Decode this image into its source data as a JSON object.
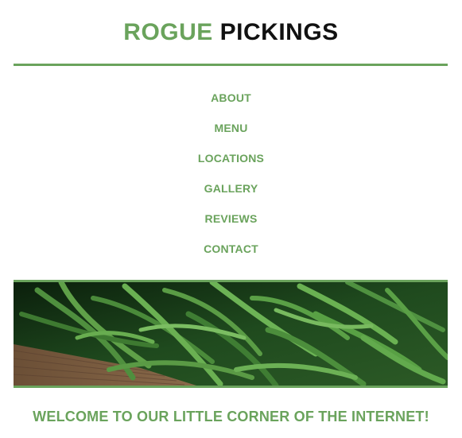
{
  "site": {
    "title_part1": "ROGUE",
    "title_part2": "PICKINGS"
  },
  "nav": {
    "items": [
      {
        "label": "ABOUT"
      },
      {
        "label": "MENU"
      },
      {
        "label": "LOCATIONS"
      },
      {
        "label": "GALLERY"
      },
      {
        "label": "REVIEWS"
      },
      {
        "label": "CONTACT"
      }
    ]
  },
  "hero": {
    "image": "green-beans-photo"
  },
  "main": {
    "welcome": "WELCOME TO OUR LITTLE CORNER OF THE INTERNET!"
  },
  "colors": {
    "accent": "#6aa35c",
    "text_dark": "#111111",
    "background": "#ffffff"
  }
}
